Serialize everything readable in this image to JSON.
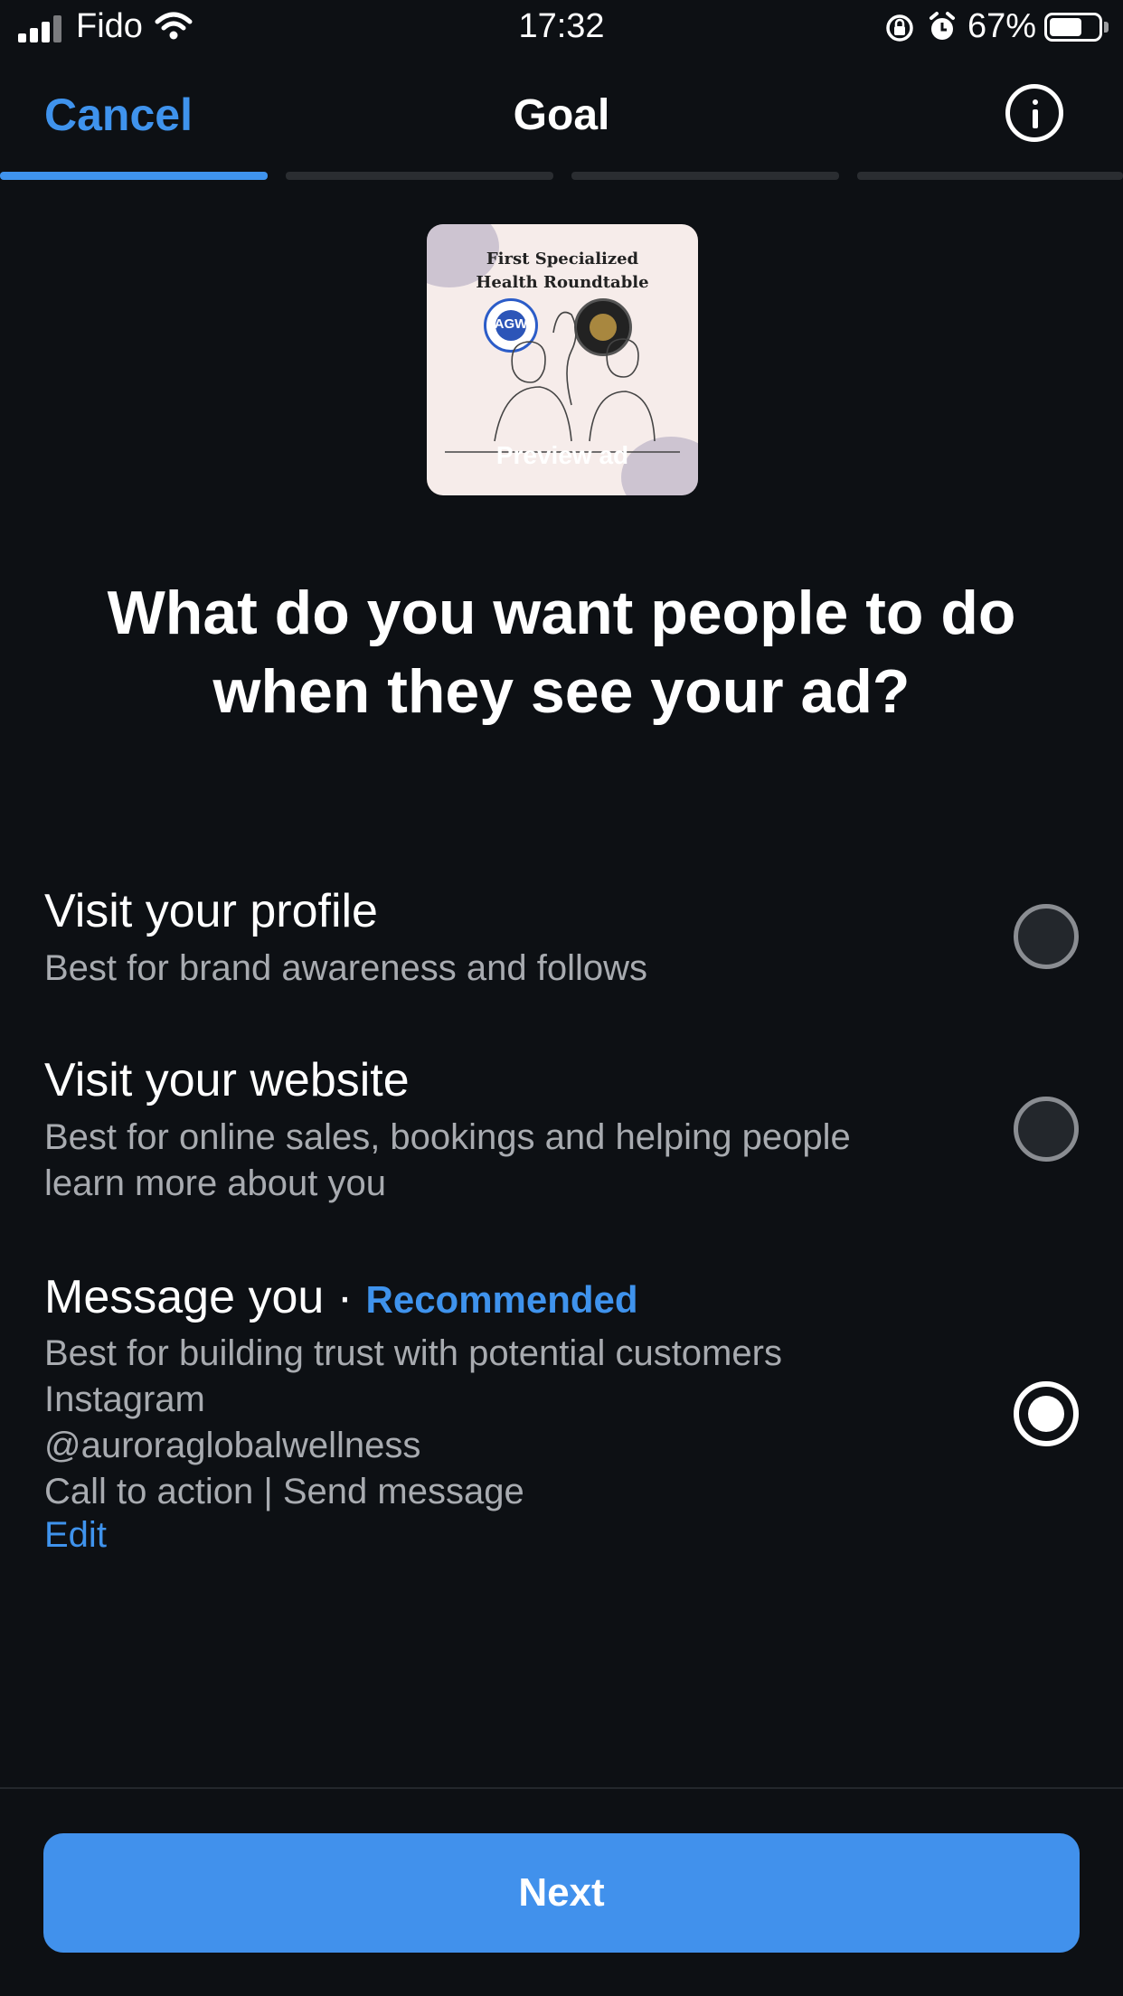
{
  "status_bar": {
    "carrier": "Fido",
    "time": "17:32",
    "battery": "67%",
    "battery_level": 0.67
  },
  "header": {
    "cancel_label": "Cancel",
    "title": "Goal"
  },
  "progress": {
    "total_steps": 4,
    "current_step": 1
  },
  "preview": {
    "card_title_line1": "First Specialized",
    "card_title_line2": "Health Roundtable",
    "logo_text": "AGW",
    "label": "Preview ad"
  },
  "question": {
    "line1": "What do you want people to do",
    "line2": "when they see your ad?"
  },
  "options": [
    {
      "title": "Visit your profile",
      "subtitle": "Best for brand awareness and follows",
      "selected": false
    },
    {
      "title": "Visit your website",
      "subtitle_line1": "Best for online sales, bookings and helping people",
      "subtitle_line2": "learn more about you",
      "selected": false
    },
    {
      "title": "Message you ·",
      "badge": "Recommended",
      "subtitle": "Best for building trust with potential customers",
      "platform": "Instagram",
      "account": "@auroraglobalwellness",
      "cta": "Call to action | Send message",
      "edit_label": "Edit",
      "selected": true
    }
  ],
  "next_label": "Next",
  "colors": {
    "background": "#0d1014",
    "accent": "#3f93ed",
    "button": "#4191ec",
    "muted_text": "#a8abb0"
  }
}
